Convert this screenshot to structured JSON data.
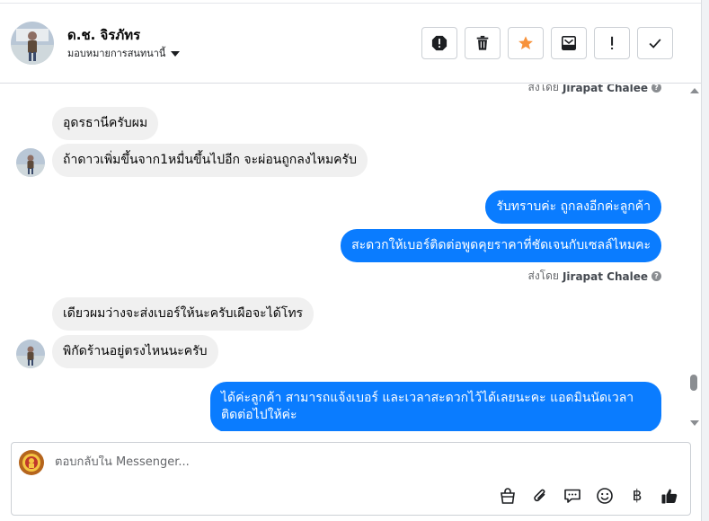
{
  "header": {
    "contact_name": "ด.ช. จิรภัทร",
    "assign_label": "มอบหมายการสนทนานี้",
    "actions": [
      {
        "icon": "spam-alert-icon"
      },
      {
        "icon": "trash-icon"
      },
      {
        "icon": "star-icon"
      },
      {
        "icon": "mark-unread-icon"
      },
      {
        "icon": "follow-up-icon"
      },
      {
        "icon": "done-check-icon"
      }
    ]
  },
  "conversation": {
    "sent_by_prefix": "ส่งโดย",
    "agent_name": "Jirapat Chalee",
    "messages": [
      {
        "text": "อุดรธานีครับผม"
      },
      {
        "text": "ถ้าดาวเพิ่มขึ้นจาก1หมื่นขึ้นไปอีก จะผ่อนถูกลงไหมครับ"
      },
      {
        "text": "รับทราบค่ะ ถูกลงอีกค่ะลูกค้า"
      },
      {
        "text": "สะดวกให้เบอร์ติดต่อพูดคุยราคาที่ชัดเจนกับเซลล์ไหมคะ"
      },
      {
        "text": "เดียวผมว่างจะส่งเบอร์ให้นะครับเผือจะได้โทร"
      },
      {
        "text": "พิกัดร้านอยู่ตรงไหนนะครับ"
      },
      {
        "text": "ได้ค่ะลูกค้า สามารถแจ้งเบอร์ และเวลาสะดวกไว้ได้เลยนะคะ แอดมินนัดเวลาติดต่อไปให้ค่ะ"
      }
    ]
  },
  "composer": {
    "placeholder": "ตอบกลับใน Messenger...",
    "currency_symbol": "฿",
    "tools": [
      "bag-icon",
      "paperclip-icon",
      "saved-reply-icon",
      "emoji-icon",
      "baht-icon",
      "thumbs-up-icon"
    ]
  },
  "colors": {
    "outgoing_bubble": "#0a7cff",
    "incoming_bubble": "#f0f0f0",
    "star": "#f7923b"
  }
}
